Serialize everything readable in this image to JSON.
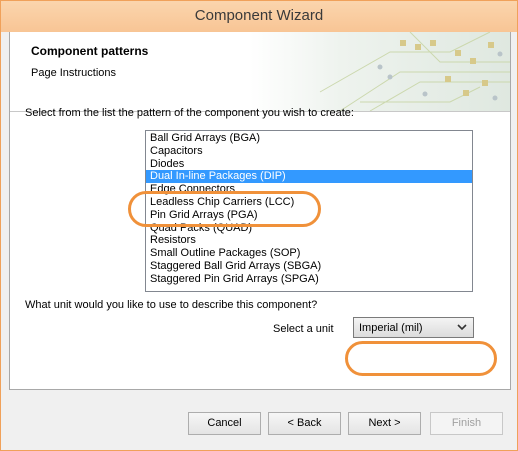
{
  "window": {
    "title": "Component Wizard"
  },
  "header": {
    "title": "Component patterns",
    "subtitle": "Page Instructions"
  },
  "main": {
    "prompt": "Select from the list the pattern of the component you wish to create:",
    "patterns": [
      "Ball Grid Arrays (BGA)",
      "Capacitors",
      "Diodes",
      "Dual In-line Packages (DIP)",
      "Edge Connectors",
      "Leadless Chip Carriers (LCC)",
      "Pin Grid Arrays (PGA)",
      "Quad Packs (QUAD)",
      "Resistors",
      "Small Outline Packages (SOP)",
      "Staggered Ball Grid Arrays (SBGA)",
      "Staggered Pin Grid Arrays (SPGA)"
    ],
    "selected_pattern": "Dual In-line Packages (DIP)",
    "unit_question": "What unit would you like to use to describe this component?",
    "unit_label": "Select a unit",
    "unit_value": "Imperial (mil)"
  },
  "buttons": {
    "cancel": "Cancel",
    "back": "< Back",
    "next": "Next >",
    "finish": "Finish"
  },
  "colors": {
    "selection": "#3399ff",
    "highlight": "#f0913a",
    "titlebar": "#f8c595"
  }
}
